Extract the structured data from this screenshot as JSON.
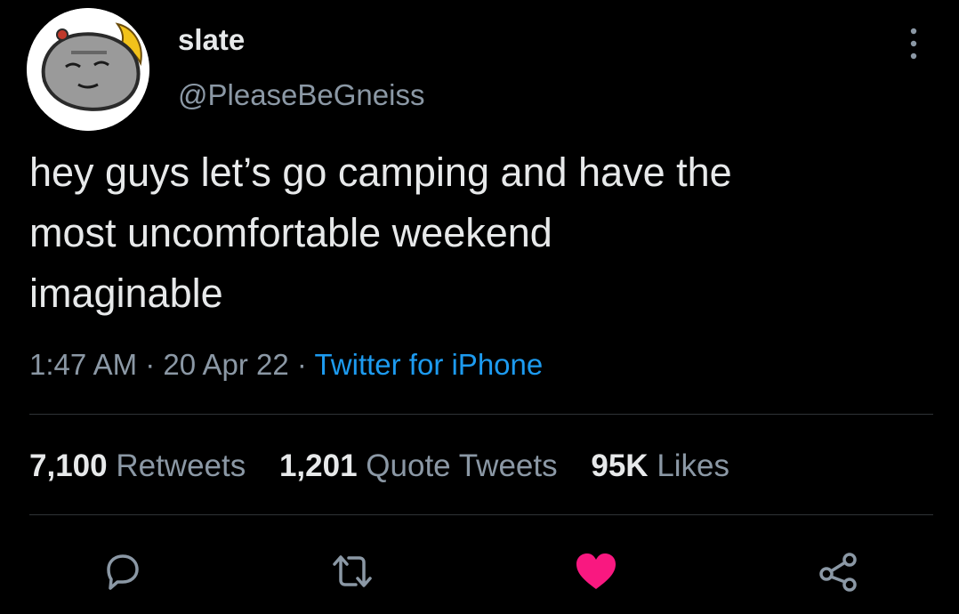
{
  "user": {
    "display_name": "slate",
    "handle": "@PleaseBeGneiss",
    "avatar_icon": "rock-avatar-icon"
  },
  "tweet": {
    "text": "hey guys let’s go camping and have the\nmost uncomfortable weekend\nimaginable",
    "time": "1:47 AM",
    "separator": "·",
    "date": "20 Apr 22",
    "source": "Twitter for iPhone"
  },
  "stats": {
    "retweets_count": "7,100",
    "retweets_label": "Retweets",
    "quotes_count": "1,201",
    "quotes_label": "Quote Tweets",
    "likes_count": "95K",
    "likes_label": "Likes"
  },
  "actions": {
    "reply_icon": "reply-icon",
    "retweet_icon": "retweet-icon",
    "like_icon": "heart-icon",
    "share_icon": "share-icon",
    "liked": true
  },
  "colors": {
    "background": "#000000",
    "text": "#e7e9ea",
    "secondary_text": "#8b98a5",
    "link": "#1d9bf0",
    "like": "#f91880",
    "divider": "#2f3336"
  }
}
